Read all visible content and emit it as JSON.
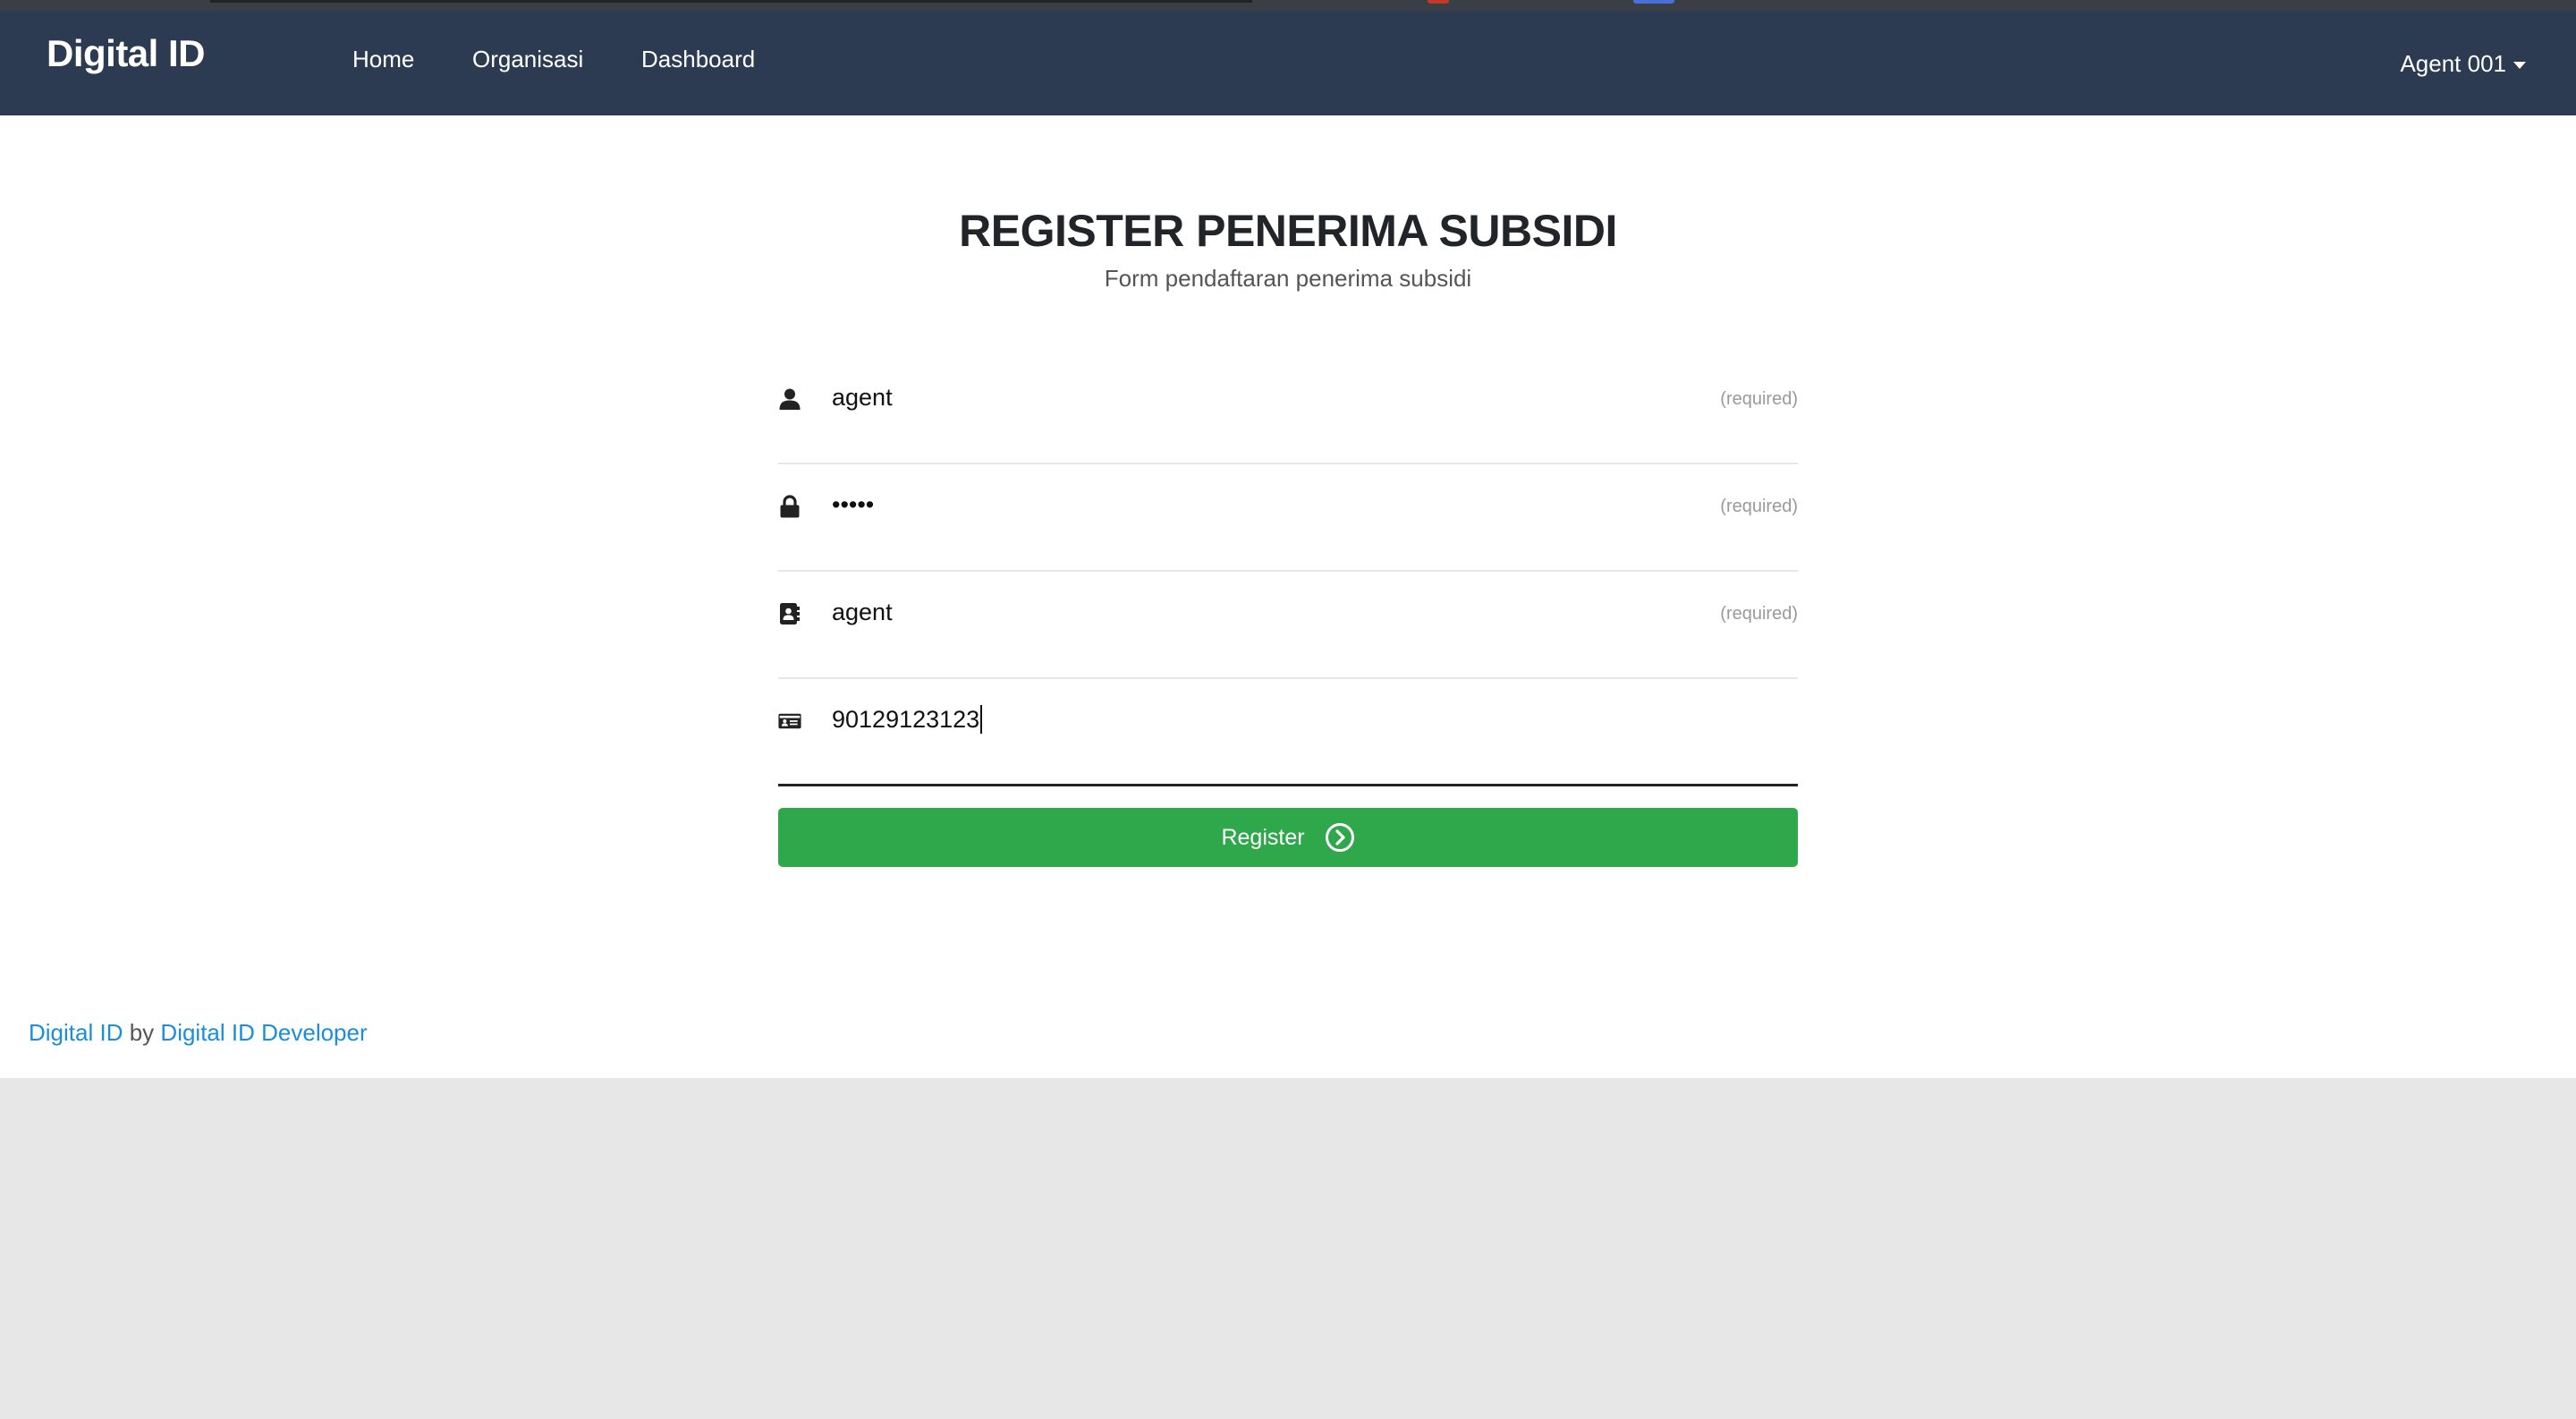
{
  "navbar": {
    "brand": "Digital ID",
    "links": [
      {
        "label": "Home"
      },
      {
        "label": "Organisasi"
      },
      {
        "label": "Dashboard"
      }
    ],
    "user_menu_label": "Agent 001"
  },
  "page": {
    "title": "REGISTER PENERIMA SUBSIDI",
    "subtitle": "Form pendaftaran penerima subsidi"
  },
  "form": {
    "fields": [
      {
        "icon": "user-icon",
        "value": "agent",
        "hint": "(required)"
      },
      {
        "icon": "lock-icon",
        "value": "•••••",
        "hint": "(required)"
      },
      {
        "icon": "contact-book-icon",
        "value": "agent",
        "hint": "(required)"
      },
      {
        "icon": "id-card-icon",
        "value": "90129123123",
        "hint": ""
      }
    ],
    "submit_label": "Register",
    "submit_icon": "chevron-circle-right-icon"
  },
  "footer": {
    "brand_link": "Digital ID",
    "by_text": "by",
    "developer_link": "Digital ID Developer"
  },
  "colors": {
    "navbar_bg": "#2c3b52",
    "submit_bg": "#2ea84b",
    "link": "#1a8ddc",
    "page_bg": "#e7e7e7"
  }
}
